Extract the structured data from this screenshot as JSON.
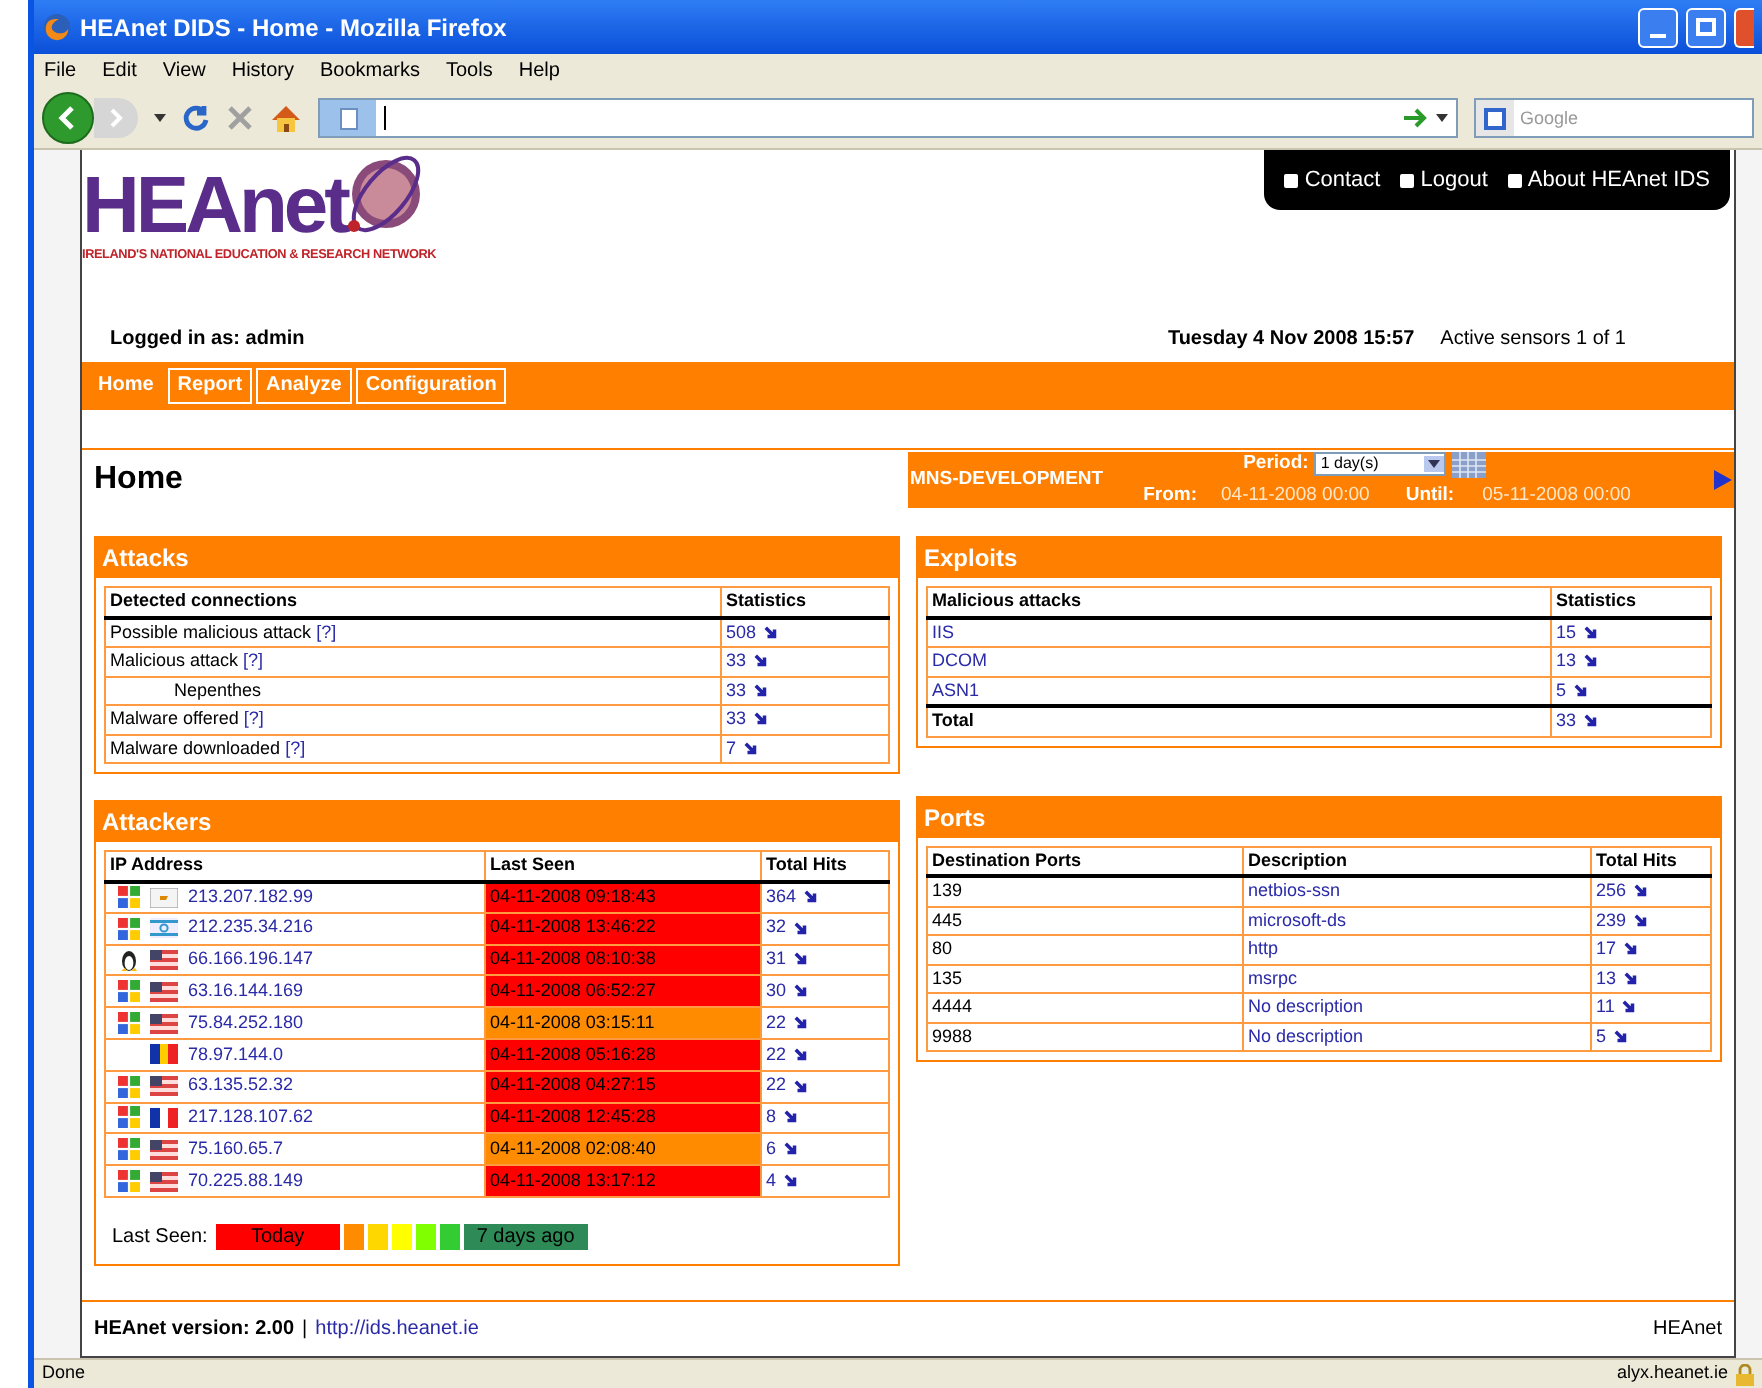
{
  "window": {
    "title": "HEAnet DIDS - Home - Mozilla Firefox"
  },
  "menu": [
    "File",
    "Edit",
    "View",
    "History",
    "Bookmarks",
    "Tools",
    "Help"
  ],
  "search": {
    "placeholder": "Google"
  },
  "logo": {
    "name": "HEAnet",
    "tagline": "IRELAND'S NATIONAL EDUCATION & RESEARCH NETWORK"
  },
  "top_links": [
    "Contact",
    "Logout",
    "About HEAnet IDS"
  ],
  "user": "Logged in as: admin",
  "date": "Tuesday 4 Nov 2008 15:57",
  "sensors": "Active sensors 1 of 1",
  "tabs": [
    {
      "label": "Home",
      "selected": true
    },
    {
      "label": "Report",
      "selected": false
    },
    {
      "label": "Analyze",
      "selected": false
    },
    {
      "label": "Configuration",
      "selected": false
    }
  ],
  "page_title": "Home",
  "sensor": {
    "name": "MNS-DEVELOPMENT",
    "period_label": "Period:",
    "period": "1 day(s)",
    "from_label": "From:",
    "from": "04-11-2008 00:00",
    "until_label": "Until:",
    "until": "05-11-2008 00:00"
  },
  "attacks": {
    "title": "Attacks",
    "columns": [
      "Detected connections",
      "Statistics"
    ],
    "rows": [
      {
        "label": "Possible malicious attack",
        "help": "[?]",
        "indented": false,
        "value": "508"
      },
      {
        "label": "Malicious attack",
        "help": "[?]",
        "indented": false,
        "value": "33"
      },
      {
        "label": "Nepenthes",
        "indented": true,
        "value": "33"
      },
      {
        "label": "Malware offered",
        "help": "[?]",
        "indented": false,
        "value": "33"
      },
      {
        "label": "Malware downloaded",
        "help": "[?]",
        "indented": false,
        "value": "7"
      }
    ]
  },
  "exploits": {
    "title": "Exploits",
    "columns": [
      "Malicious attacks",
      "Statistics"
    ],
    "rows": [
      {
        "label": "IIS",
        "value": "15"
      },
      {
        "label": "DCOM",
        "value": "13"
      },
      {
        "label": "ASN1",
        "value": "5"
      }
    ],
    "total": {
      "label": "Total",
      "value": "33"
    }
  },
  "attackers": {
    "title": "Attackers",
    "columns": [
      "IP Address",
      "Last Seen",
      "Total Hits"
    ],
    "rows": [
      {
        "os": {
          "kind": "windows"
        },
        "flag": {
          "kind": "cy"
        },
        "ip": "213.207.182.99",
        "last_seen": "04-11-2008 09:18:43",
        "color": "#ff0000",
        "hits": "364"
      },
      {
        "os": {
          "kind": "windows"
        },
        "flag": {
          "kind": "il"
        },
        "ip": "212.235.34.216",
        "last_seen": "04-11-2008 13:46:22",
        "color": "#ff0000",
        "hits": "32"
      },
      {
        "os": {
          "kind": "linux"
        },
        "flag": {
          "kind": "us"
        },
        "ip": "66.166.196.147",
        "last_seen": "04-11-2008 08:10:38",
        "color": "#ff0000",
        "hits": "31"
      },
      {
        "os": {
          "kind": "windows"
        },
        "flag": {
          "kind": "us"
        },
        "ip": "63.16.144.169",
        "last_seen": "04-11-2008 06:52:27",
        "color": "#ff0000",
        "hits": "30"
      },
      {
        "os": {
          "kind": "windows"
        },
        "flag": {
          "kind": "us"
        },
        "ip": "75.84.252.180",
        "last_seen": "04-11-2008 03:15:11",
        "color": "#ff8c00",
        "hits": "22"
      },
      {
        "os": {
          "kind": "none"
        },
        "flag": {
          "kind": "ro"
        },
        "ip": "78.97.144.0",
        "last_seen": "04-11-2008 05:16:28",
        "color": "#ff0000",
        "hits": "22"
      },
      {
        "os": {
          "kind": "windows"
        },
        "flag": {
          "kind": "us"
        },
        "ip": "63.135.52.32",
        "last_seen": "04-11-2008 04:27:15",
        "color": "#ff0000",
        "hits": "22"
      },
      {
        "os": {
          "kind": "windows"
        },
        "flag": {
          "kind": "fr"
        },
        "ip": "217.128.107.62",
        "last_seen": "04-11-2008 12:45:28",
        "color": "#ff0000",
        "hits": "8"
      },
      {
        "os": {
          "kind": "windows"
        },
        "flag": {
          "kind": "us"
        },
        "ip": "75.160.65.7",
        "last_seen": "04-11-2008 02:08:40",
        "color": "#ff8c00",
        "hits": "6"
      },
      {
        "os": {
          "kind": "windows"
        },
        "flag": {
          "kind": "us"
        },
        "ip": "70.225.88.149",
        "last_seen": "04-11-2008 13:17:12",
        "color": "#ff0000",
        "hits": "4"
      }
    ],
    "legend": {
      "label": "Last Seen:",
      "items": [
        {
          "text": "Today",
          "color": "#ff0000"
        },
        {
          "color": "#ff8c00"
        },
        {
          "color": "#ffd700"
        },
        {
          "color": "#ffff00"
        },
        {
          "color": "#80ff00"
        },
        {
          "color": "#33cc33"
        },
        {
          "text": "7 days ago",
          "color": "#2e8b57"
        }
      ]
    }
  },
  "ports": {
    "title": "Ports",
    "columns": [
      "Destination Ports",
      "Description",
      "Total Hits"
    ],
    "rows": [
      {
        "port": "139",
        "description": "netbios-ssn",
        "hits": "256"
      },
      {
        "port": "445",
        "description": "microsoft-ds",
        "hits": "239"
      },
      {
        "port": "80",
        "description": "http",
        "hits": "17"
      },
      {
        "port": "135",
        "description": "msrpc",
        "hits": "13"
      },
      {
        "port": "4444",
        "description": "No description",
        "hits": "11"
      },
      {
        "port": "9988",
        "description": "No description",
        "hits": "5"
      }
    ]
  },
  "footer": {
    "version": "HEAnet version: 2.00",
    "separator": "|",
    "link": "http://ids.heanet.ie",
    "brand": "HEAnet"
  },
  "status_bar": {
    "text": "Done",
    "host": "alyx.heanet.ie"
  }
}
